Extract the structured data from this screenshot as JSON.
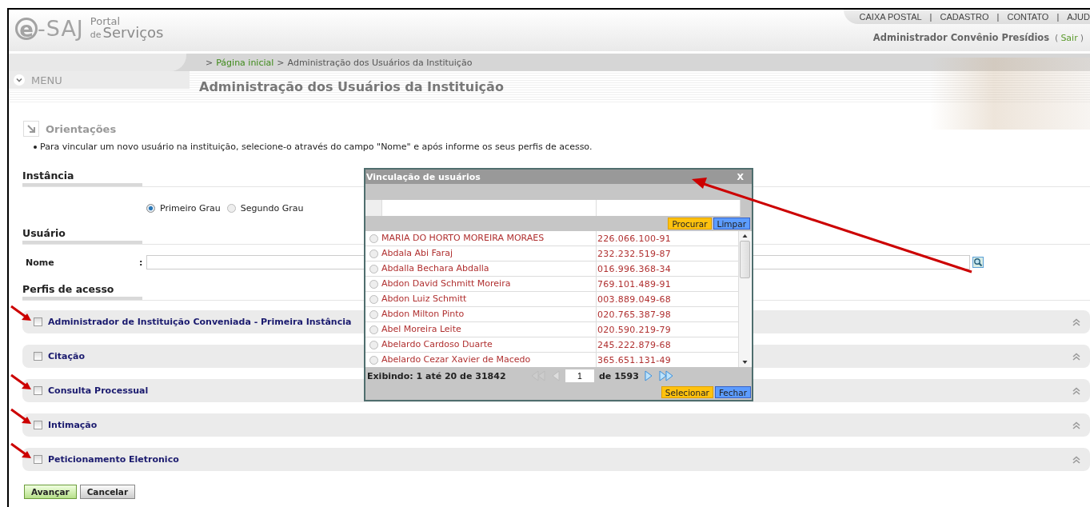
{
  "header": {
    "logo": {
      "mark": "e",
      "name": "-SAJ",
      "portal": "Portal",
      "de": "de",
      "servicos": "Serviços"
    },
    "top_links": [
      {
        "label": "CAIXA POSTAL"
      },
      {
        "label": "CADASTRO"
      },
      {
        "label": "CONTATO"
      },
      {
        "label": "AJUD"
      }
    ],
    "link_separator": "|",
    "user": {
      "name": "Administrador Convênio Presídios",
      "prefix": "(",
      "logout": "Sair",
      "suffix": ")"
    }
  },
  "breadcrumb": {
    "separator": ">",
    "items": [
      {
        "label": "Página inicial",
        "link": true
      },
      {
        "label": "Administração dos Usuários da Instituição",
        "link": false
      }
    ]
  },
  "menu": "MENU",
  "page_title": "Administração dos Usuários da Instituição",
  "orientations": {
    "title": "Orientações",
    "bullets": [
      "Para vincular um novo usuário na instituição, selecione-o através do campo \"Nome\" e após informe os seus perfis de acesso."
    ]
  },
  "instance": {
    "title": "Instância",
    "options": [
      {
        "label": "Primeiro Grau",
        "selected": true
      },
      {
        "label": "Segundo Grau",
        "selected": false
      }
    ]
  },
  "user_section": {
    "title": "Usuário",
    "field_label": "Nome",
    "colon": ":"
  },
  "profiles": {
    "title": "Perfis de acesso",
    "items": [
      {
        "label": "Administrador de Instituição Conveniada - Primeira Instância",
        "checked": false,
        "annotated": true
      },
      {
        "label": "Citação",
        "checked": false,
        "annotated": false
      },
      {
        "label": "Consulta Processual",
        "checked": false,
        "annotated": true
      },
      {
        "label": "Intimação",
        "checked": false,
        "annotated": true
      },
      {
        "label": "Peticionamento Eletronico",
        "checked": false,
        "annotated": true
      }
    ]
  },
  "buttons": [
    {
      "label": "Avançar",
      "kind": "primary"
    },
    {
      "label": "Cancelar",
      "kind": "secondary"
    }
  ],
  "dialog": {
    "title": "Vinculação de usuários",
    "close": "X",
    "search_buttons": [
      {
        "label": "Procurar",
        "kind": "search"
      },
      {
        "label": "Limpar",
        "kind": "clear"
      }
    ],
    "rows": [
      {
        "name": "MARIA DO HORTO MOREIRA MORAES",
        "cpf": "226.066.100-91",
        "selected": false
      },
      {
        "name": "Abdala Abi Faraj",
        "cpf": "232.232.519-87",
        "selected": false
      },
      {
        "name": "Abdalla Bechara Abdalla",
        "cpf": "016.996.368-34",
        "selected": false
      },
      {
        "name": "Abdon David Schmitt Moreira",
        "cpf": "769.101.489-91",
        "selected": false
      },
      {
        "name": "Abdon Luiz Schmitt",
        "cpf": "003.889.049-68",
        "selected": false
      },
      {
        "name": "Abdon Milton Pinto",
        "cpf": "020.765.387-98",
        "selected": false
      },
      {
        "name": "Abel Moreira Leite",
        "cpf": "020.590.219-79",
        "selected": false
      },
      {
        "name": "Abelardo Cardoso Duarte",
        "cpf": "245.222.879-68",
        "selected": false
      },
      {
        "name": "Abelardo Cezar Xavier de Macedo",
        "cpf": "365.651.131-49",
        "selected": false
      }
    ],
    "status": "Exibindo: 1 até 20 de 31842",
    "page": "1",
    "page_total": "de 1593",
    "actions": [
      {
        "label": "Selecionar",
        "kind": "search"
      },
      {
        "label": "Fechar",
        "kind": "clear"
      }
    ]
  }
}
